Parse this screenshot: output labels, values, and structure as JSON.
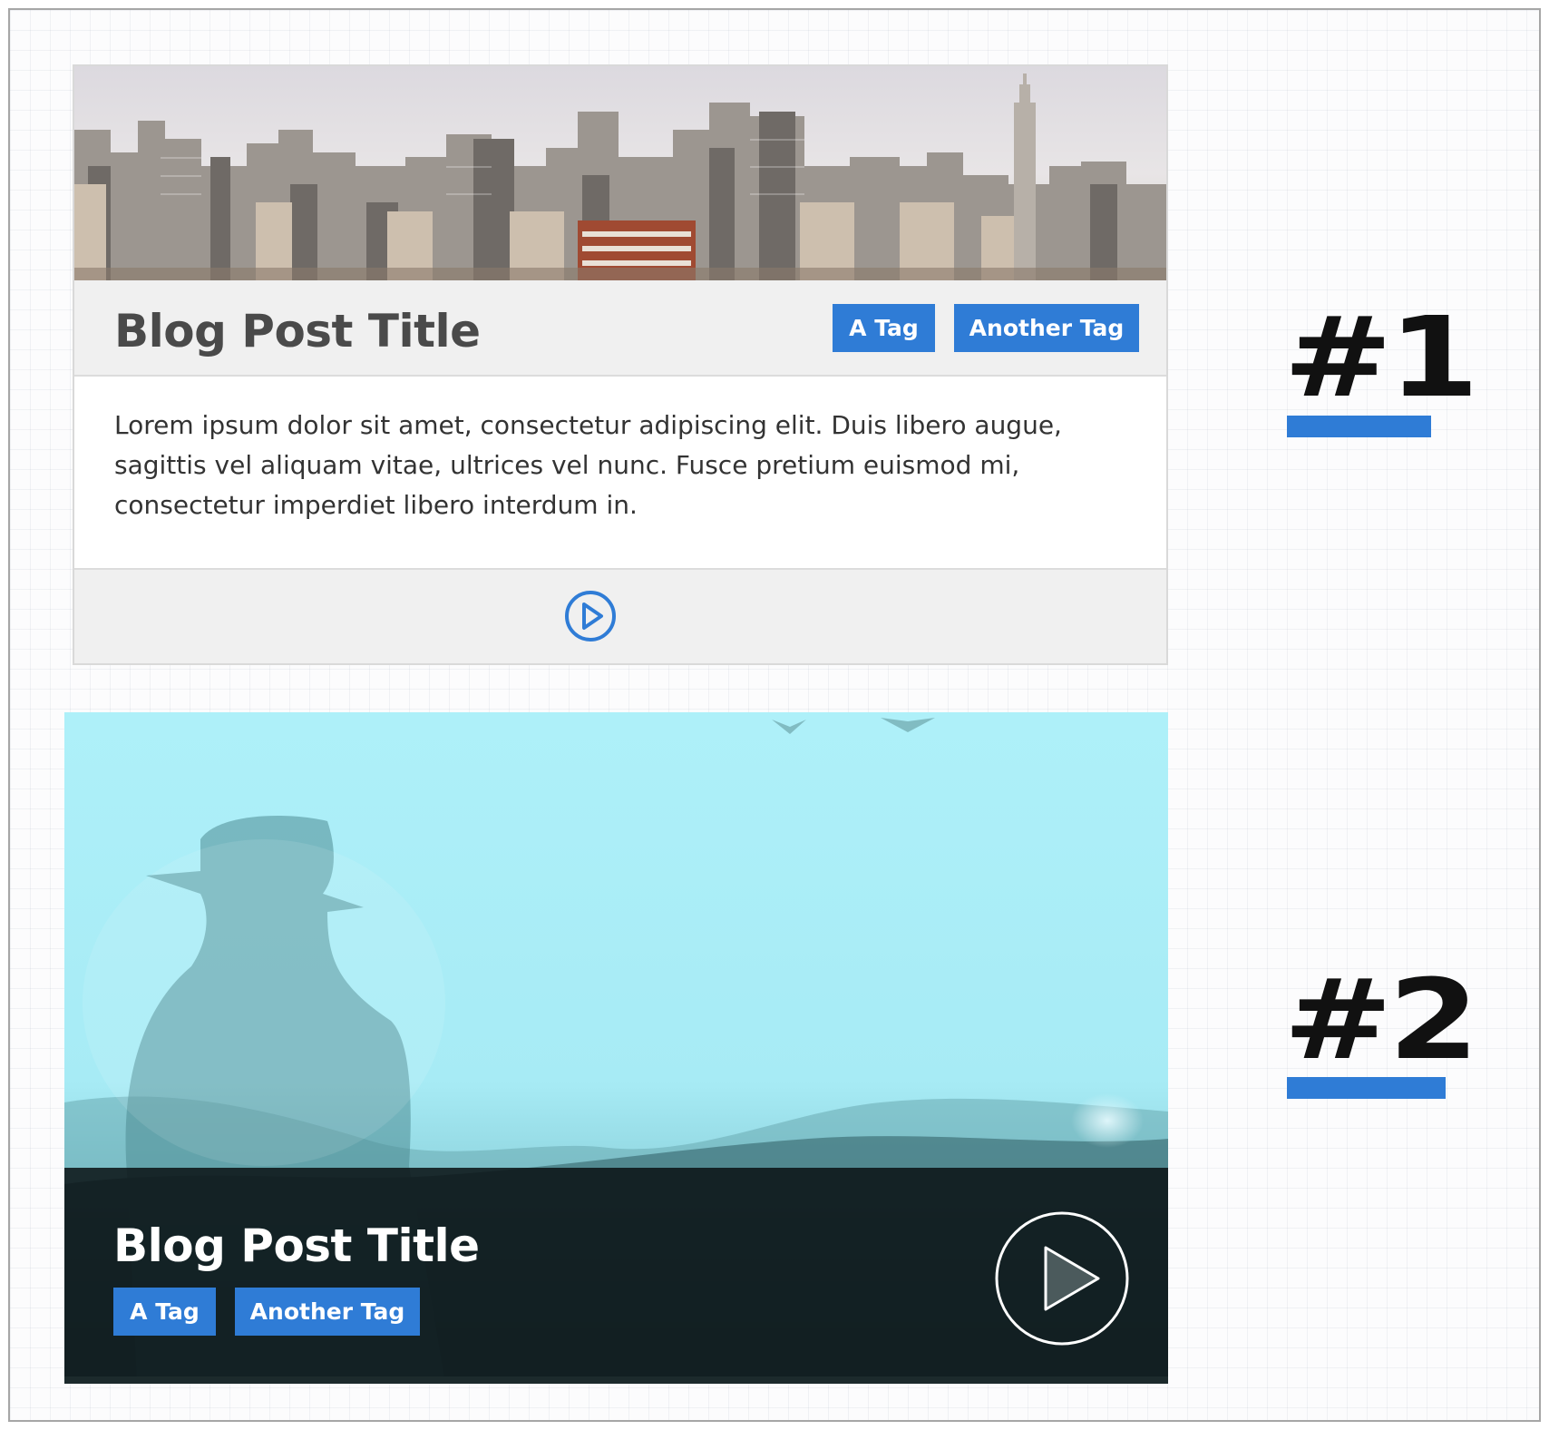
{
  "card1": {
    "title": "Blog Post Title",
    "tags": [
      "A Tag",
      "Another Tag"
    ],
    "excerpt": "Lorem ipsum dolor sit amet, consectetur adipiscing elit. Duis libero augue, sagittis vel aliquam vitae, ultrices vel nunc. Fusce pretium euismod mi, consectetur imperdiet libero interdum in.",
    "image": "city-skyline-photo",
    "play_icon": "play-circle-icon"
  },
  "card2": {
    "title": "Blog Post Title",
    "tags": [
      "A Tag",
      "Another Tag"
    ],
    "image": "person-with-hat-landscape-photo",
    "play_icon": "play-circle-icon"
  },
  "labels": {
    "first": "#1",
    "second": "#2"
  },
  "colors": {
    "accent": "#2f7cd6",
    "title_dark": "#4a4a4a",
    "card_header_bg": "#f0f0f0",
    "overlay_dark": "#0a1214",
    "sky_cyan": "#aeeff8"
  }
}
